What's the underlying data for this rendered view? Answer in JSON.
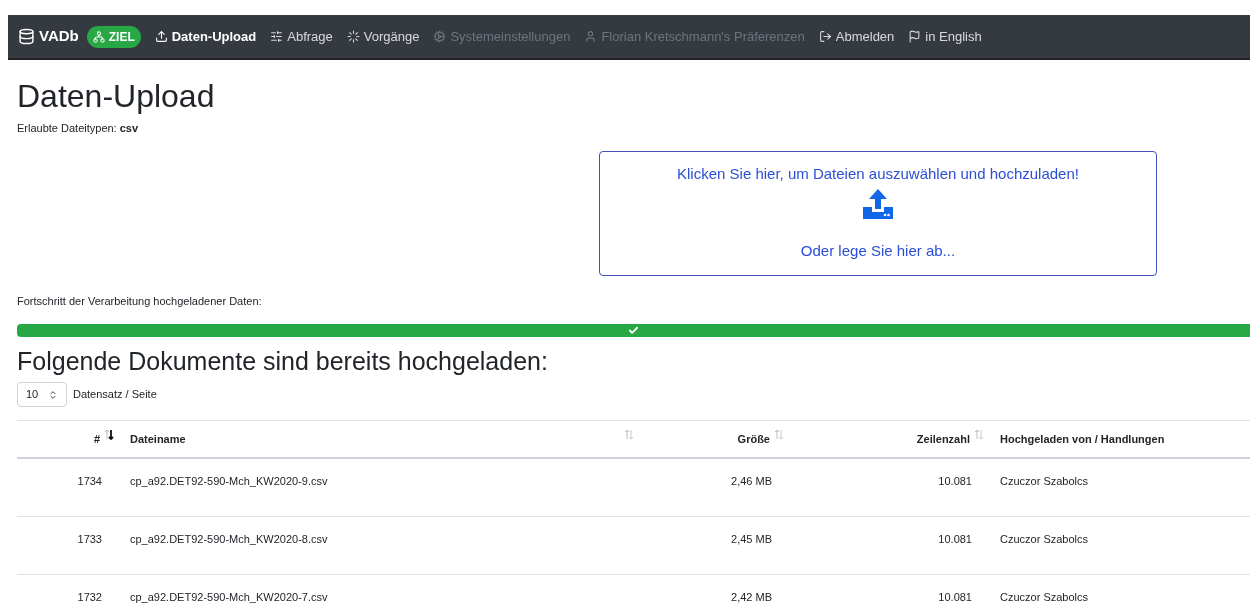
{
  "navbar": {
    "brand": "VADb",
    "badge": "ZIEL",
    "items": [
      {
        "label": "Daten-Upload",
        "selected": true,
        "disabled": false
      },
      {
        "label": "Abfrage",
        "selected": false,
        "disabled": false
      },
      {
        "label": "Vorgänge",
        "selected": false,
        "disabled": false
      },
      {
        "label": "Systemeinstellungen",
        "selected": false,
        "disabled": true
      },
      {
        "label": "Florian Kretschmann's Präferenzen",
        "selected": false,
        "disabled": true
      },
      {
        "label": "Abmelden",
        "selected": false,
        "disabled": false
      },
      {
        "label": "in English",
        "selected": false,
        "disabled": false
      }
    ]
  },
  "title": "Daten-Upload",
  "allowed_types": "Erlaubte Dateitypen: **csv**",
  "dropzone": {
    "prompt": "Klicken Sie hier, um Dateien auszuwählen und hochzuladen!",
    "drop_hint": "Oder lege Sie hier ab..."
  },
  "progress": {
    "label": "Fortschritt der Verarbeitung hochgeladener Daten:",
    "level": 1
  },
  "list_title": "Folgende Dokumente sind bereits hochgeladen:",
  "page_size": {
    "value": "10",
    "label": "Datensatz / Seite"
  },
  "table": {
    "columns": [
      {
        "label": "#",
        "sortable": true,
        "sorted": true
      },
      {
        "label": "Dateiname",
        "sortable": true,
        "sorted": false
      },
      {
        "label": "Größe",
        "sortable": true,
        "sorted": false
      },
      {
        "label": "Zeilenzahl",
        "sortable": true,
        "sorted": false
      },
      {
        "label": "Hochgeladen von / Handlungen",
        "sortable": false
      }
    ],
    "rows": [
      [
        "1734",
        "cp_a92.DET92-590-Mch_KW2020-9.csv",
        "2,46 MB",
        "10.081",
        "Czuczor Szabolcs"
      ],
      [
        "1733",
        "cp_a92.DET92-590-Mch_KW2020-8.csv",
        "2,45 MB",
        "10.081",
        "Czuczor Szabolcs"
      ],
      [
        "1732",
        "cp_a92.DET92-590-Mch_KW2020-7.csv",
        "2,42 MB",
        "10.081",
        "Czuczor Szabolcs"
      ]
    ]
  }
}
